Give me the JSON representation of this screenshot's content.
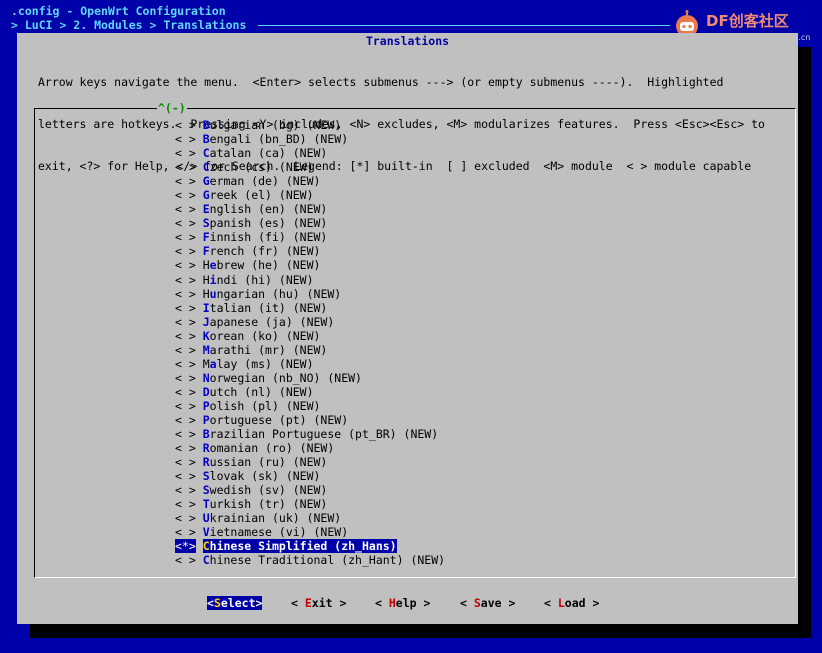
{
  "header": {
    "line1": ".config - OpenWrt Configuration",
    "line2": "> LuCI > 2. Modules > Translations"
  },
  "watermark": {
    "brand": "DF创客社区",
    "site": "mc.DFRobot.com.cn"
  },
  "dialog": {
    "title": "Translations",
    "help_lines": [
      "Arrow keys navigate the menu.  <Enter> selects submenus ---> (or empty submenus ----).  Highlighted",
      "letters are hotkeys.  Pressing <Y> includes, <N> excludes, <M> modularizes features.  Press <Esc><Esc> to",
      "exit, <?> for Help, </> for Search.  Legend: [*] built-in  [ ] excluded  <M> module  < > module capable"
    ],
    "scroll_indicator": "^(-)"
  },
  "items": [
    {
      "mark": "< >",
      "pre": "",
      "hk": "B",
      "post": "ulgarian (bg) (NEW)",
      "selected": false
    },
    {
      "mark": "< >",
      "pre": "",
      "hk": "B",
      "post": "engali (bn_BD) (NEW)",
      "selected": false
    },
    {
      "mark": "< >",
      "pre": "",
      "hk": "C",
      "post": "atalan (ca) (NEW)",
      "selected": false
    },
    {
      "mark": "< >",
      "pre": "",
      "hk": "C",
      "post": "zech (cs) (NEW)",
      "selected": false
    },
    {
      "mark": "< >",
      "pre": "",
      "hk": "G",
      "post": "erman (de) (NEW)",
      "selected": false
    },
    {
      "mark": "< >",
      "pre": "",
      "hk": "G",
      "post": "reek (el) (NEW)",
      "selected": false
    },
    {
      "mark": "< >",
      "pre": "",
      "hk": "E",
      "post": "nglish (en) (NEW)",
      "selected": false
    },
    {
      "mark": "< >",
      "pre": "",
      "hk": "S",
      "post": "panish (es) (NEW)",
      "selected": false
    },
    {
      "mark": "< >",
      "pre": "",
      "hk": "F",
      "post": "innish (fi) (NEW)",
      "selected": false
    },
    {
      "mark": "< >",
      "pre": "",
      "hk": "F",
      "post": "rench (fr) (NEW)",
      "selected": false
    },
    {
      "mark": "< >",
      "pre": "H",
      "hk": "e",
      "post": "brew (he) (NEW)",
      "selected": false
    },
    {
      "mark": "< >",
      "pre": "H",
      "hk": "i",
      "post": "ndi (hi) (NEW)",
      "selected": false
    },
    {
      "mark": "< >",
      "pre": "H",
      "hk": "u",
      "post": "ngarian (hu) (NEW)",
      "selected": false
    },
    {
      "mark": "< >",
      "pre": "",
      "hk": "I",
      "post": "talian (it) (NEW)",
      "selected": false
    },
    {
      "mark": "< >",
      "pre": "",
      "hk": "J",
      "post": "apanese (ja) (NEW)",
      "selected": false
    },
    {
      "mark": "< >",
      "pre": "",
      "hk": "K",
      "post": "orean (ko) (NEW)",
      "selected": false
    },
    {
      "mark": "< >",
      "pre": "",
      "hk": "M",
      "post": "arathi (mr) (NEW)",
      "selected": false
    },
    {
      "mark": "< >",
      "pre": "M",
      "hk": "a",
      "post": "lay (ms) (NEW)",
      "selected": false
    },
    {
      "mark": "< >",
      "pre": "",
      "hk": "N",
      "post": "orwegian (nb_NO) (NEW)",
      "selected": false
    },
    {
      "mark": "< >",
      "pre": "",
      "hk": "D",
      "post": "utch (nl) (NEW)",
      "selected": false
    },
    {
      "mark": "< >",
      "pre": "",
      "hk": "P",
      "post": "olish (pl) (NEW)",
      "selected": false
    },
    {
      "mark": "< >",
      "pre": "",
      "hk": "P",
      "post": "ortuguese (pt) (NEW)",
      "selected": false
    },
    {
      "mark": "< >",
      "pre": "",
      "hk": "B",
      "post": "razilian Portuguese (pt_BR) (NEW)",
      "selected": false
    },
    {
      "mark": "< >",
      "pre": "",
      "hk": "R",
      "post": "omanian (ro) (NEW)",
      "selected": false
    },
    {
      "mark": "< >",
      "pre": "",
      "hk": "R",
      "post": "ussian (ru) (NEW)",
      "selected": false
    },
    {
      "mark": "< >",
      "pre": "",
      "hk": "S",
      "post": "lovak (sk) (NEW)",
      "selected": false
    },
    {
      "mark": "< >",
      "pre": "",
      "hk": "S",
      "post": "wedish (sv) (NEW)",
      "selected": false
    },
    {
      "mark": "< >",
      "pre": "",
      "hk": "T",
      "post": "urkish (tr) (NEW)",
      "selected": false
    },
    {
      "mark": "< >",
      "pre": "",
      "hk": "U",
      "post": "krainian (uk) (NEW)",
      "selected": false
    },
    {
      "mark": "< >",
      "pre": "",
      "hk": "V",
      "post": "ietnamese (vi) (NEW)",
      "selected": false
    },
    {
      "mark": "<*>",
      "pre": "",
      "hk": "C",
      "post": "hinese Simplified (zh_Hans)",
      "selected": true
    },
    {
      "mark": "< >",
      "pre": "",
      "hk": "C",
      "post": "hinese Traditional (zh_Hant) (NEW)",
      "selected": false
    }
  ],
  "buttons": [
    {
      "open": "<",
      "hk": "S",
      "rest": "elect",
      "close": ">",
      "active": true
    },
    {
      "open": "< ",
      "hk": "E",
      "rest": "xit",
      "close": " >",
      "active": false
    },
    {
      "open": "< ",
      "hk": "H",
      "rest": "elp",
      "close": " >",
      "active": false
    },
    {
      "open": "< ",
      "hk": "S",
      "rest": "ave",
      "close": " >",
      "active": false
    },
    {
      "open": "< ",
      "hk": "L",
      "rest": "oad",
      "close": " >",
      "active": false
    }
  ],
  "colors": {
    "screen_bg": "#0000a8",
    "dialog_bg": "#c0c0c0",
    "title": "#0000a8",
    "hotkey": "#0000c8",
    "button_hotkey": "#c00000",
    "selection": "#0000a8"
  }
}
